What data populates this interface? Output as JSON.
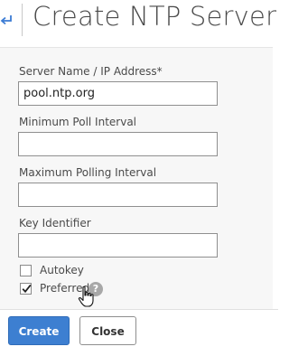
{
  "header": {
    "title": "Create NTP Server",
    "back_icon": "back-arrow-icon"
  },
  "form": {
    "server_name": {
      "label": "Server Name / IP Address*",
      "value": "pool.ntp.org"
    },
    "min_poll": {
      "label": "Minimum Poll Interval",
      "value": ""
    },
    "max_poll": {
      "label": "Maximum Polling Interval",
      "value": ""
    },
    "key_id": {
      "label": "Key Identifier",
      "value": ""
    },
    "autokey": {
      "label": "Autokey",
      "checked": false
    },
    "preferred": {
      "label": "Preferred",
      "checked": true
    },
    "help_glyph": "?"
  },
  "footer": {
    "create_label": "Create",
    "close_label": "Close"
  },
  "colors": {
    "primary": "#3d7fd1",
    "back_arrow": "#3b7bd4"
  }
}
